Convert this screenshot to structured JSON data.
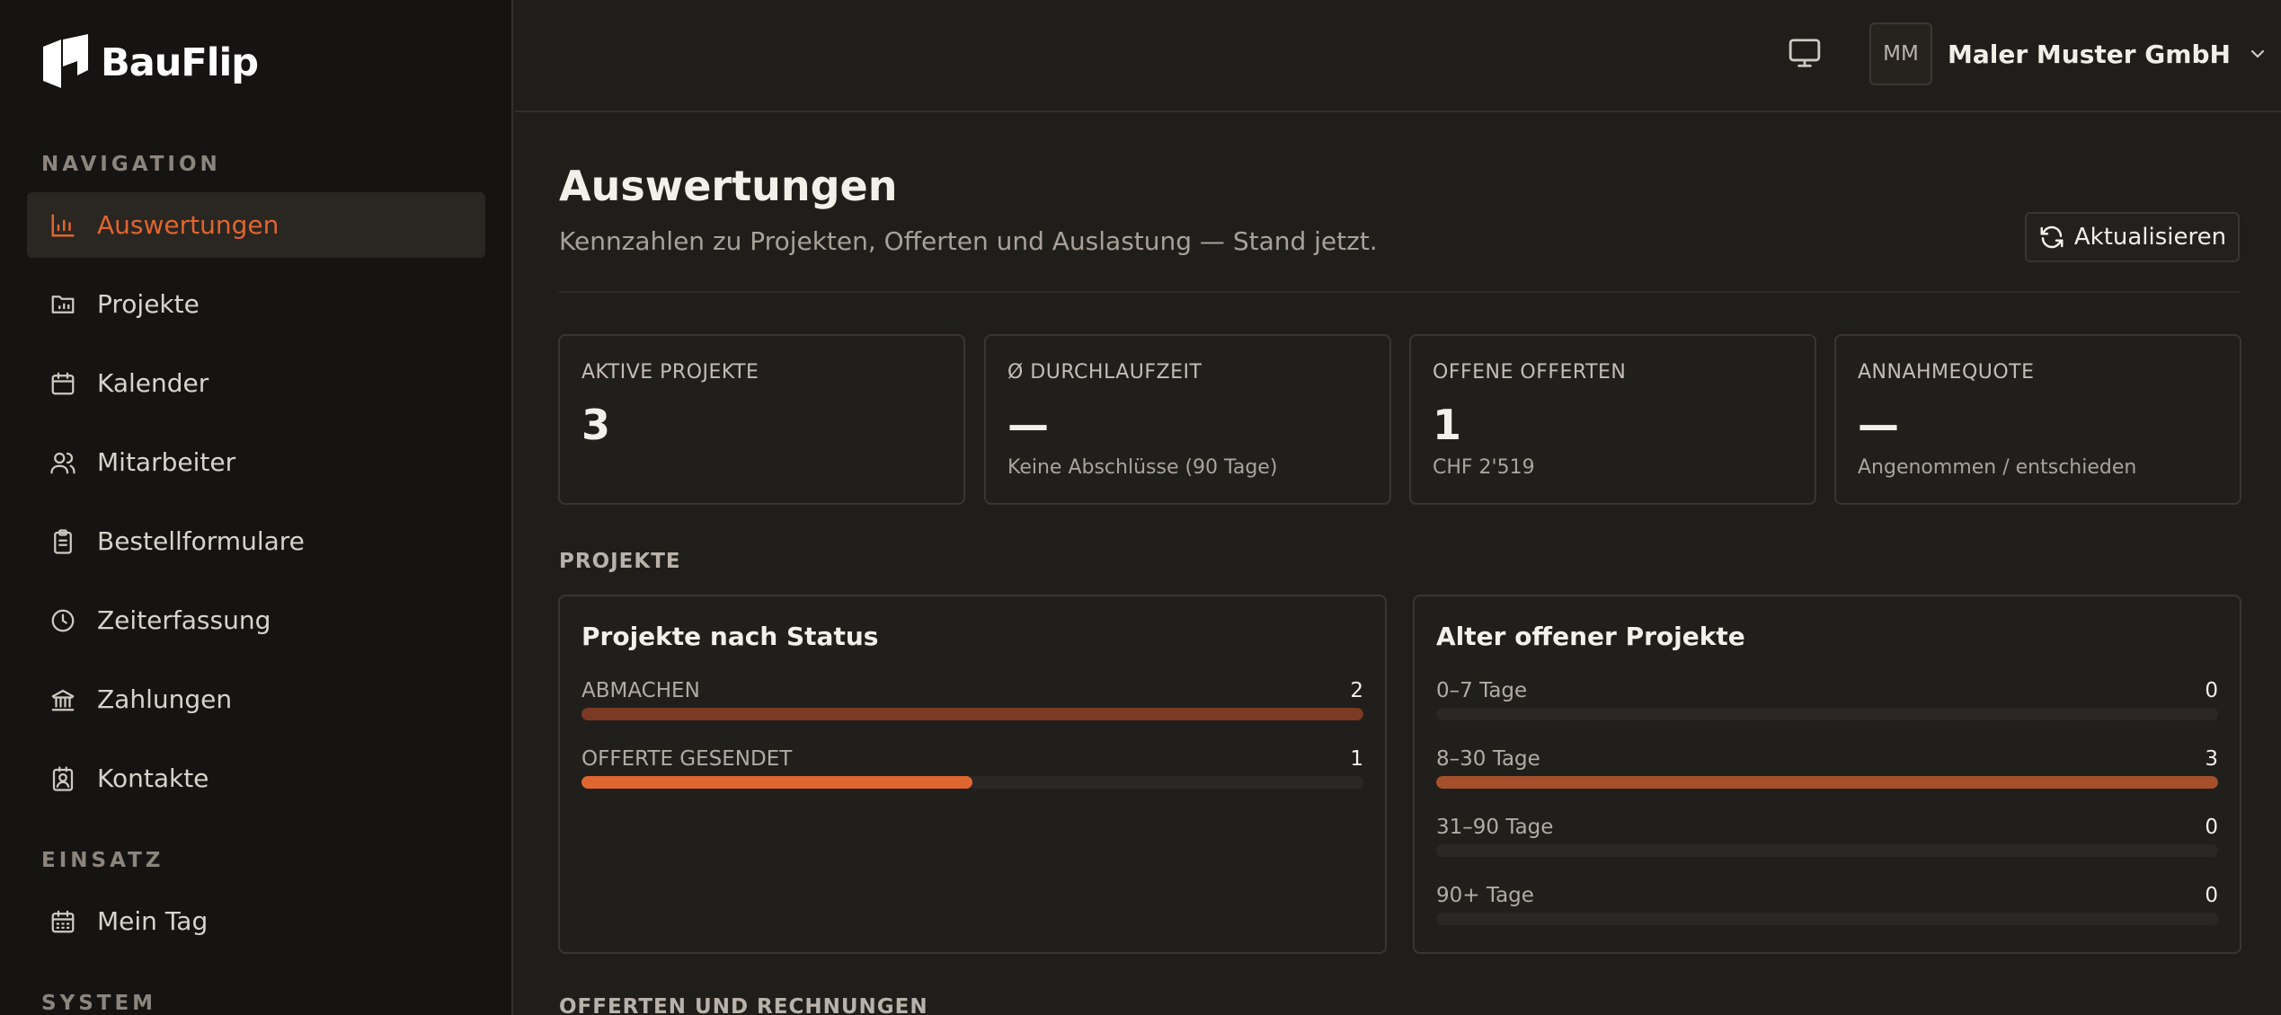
{
  "brand": {
    "name": "BauFlip"
  },
  "sidebar": {
    "sections": [
      {
        "label": "NAVIGATION"
      },
      {
        "label": "EINSATZ"
      },
      {
        "label": "SYSTEM"
      }
    ],
    "items": [
      {
        "label": "Auswertungen",
        "icon": "bar-chart-icon",
        "active": true
      },
      {
        "label": "Projekte",
        "icon": "folder-chart-icon"
      },
      {
        "label": "Kalender",
        "icon": "calendar-icon"
      },
      {
        "label": "Mitarbeiter",
        "icon": "users-icon"
      },
      {
        "label": "Bestellformulare",
        "icon": "clipboard-icon"
      },
      {
        "label": "Zeiterfassung",
        "icon": "clock-icon"
      },
      {
        "label": "Zahlungen",
        "icon": "bank-icon"
      },
      {
        "label": "Kontakte",
        "icon": "contact-icon"
      },
      {
        "label": "Mein Tag",
        "icon": "calendar-days-icon"
      }
    ]
  },
  "header": {
    "avatar_initials": "MM",
    "company": "Maler Muster GmbH"
  },
  "page": {
    "title": "Auswertungen",
    "subtitle": "Kennzahlen zu Projekten, Offerten und Auslastung — Stand jetzt.",
    "refresh_label": "Aktualisieren"
  },
  "kpis": [
    {
      "label": "AKTIVE PROJEKTE",
      "value": "3",
      "sub": ""
    },
    {
      "label": "Ø DURCHLAUFZEIT",
      "value": "—",
      "sub": "Keine Abschlüsse (90 Tage)"
    },
    {
      "label": "OFFENE OFFERTEN",
      "value": "1",
      "sub": "CHF 2'519"
    },
    {
      "label": "ANNAHMEQUOTE",
      "value": "—",
      "sub": "Angenommen / entschieden"
    }
  ],
  "sections": {
    "projekte": "PROJEKTE",
    "offerten": "OFFERTEN UND RECHNUNGEN"
  },
  "status_panel": {
    "title": "Projekte nach Status",
    "rows": [
      {
        "label": "ABMACHEN",
        "value": "2",
        "fraction": 1.0,
        "color": "#7a3a24"
      },
      {
        "label": "OFFERTE GESENDET",
        "value": "1",
        "fraction": 0.5,
        "color": "#e0662f"
      }
    ]
  },
  "age_panel": {
    "title": "Alter offener Projekte",
    "rows": [
      {
        "label": "0–7 Tage",
        "value": "0",
        "fraction": 0,
        "color": "#a5502b"
      },
      {
        "label": "8–30 Tage",
        "value": "3",
        "fraction": 1.0,
        "color": "#a5502b"
      },
      {
        "label": "31–90 Tage",
        "value": "0",
        "fraction": 0,
        "color": "#a5502b"
      },
      {
        "label": "90+ Tage",
        "value": "0",
        "fraction": 0,
        "color": "#a5502b"
      }
    ]
  },
  "colors": {
    "accent": "#e0662f",
    "bg": "#201e1b",
    "sidebar": "#161412"
  }
}
